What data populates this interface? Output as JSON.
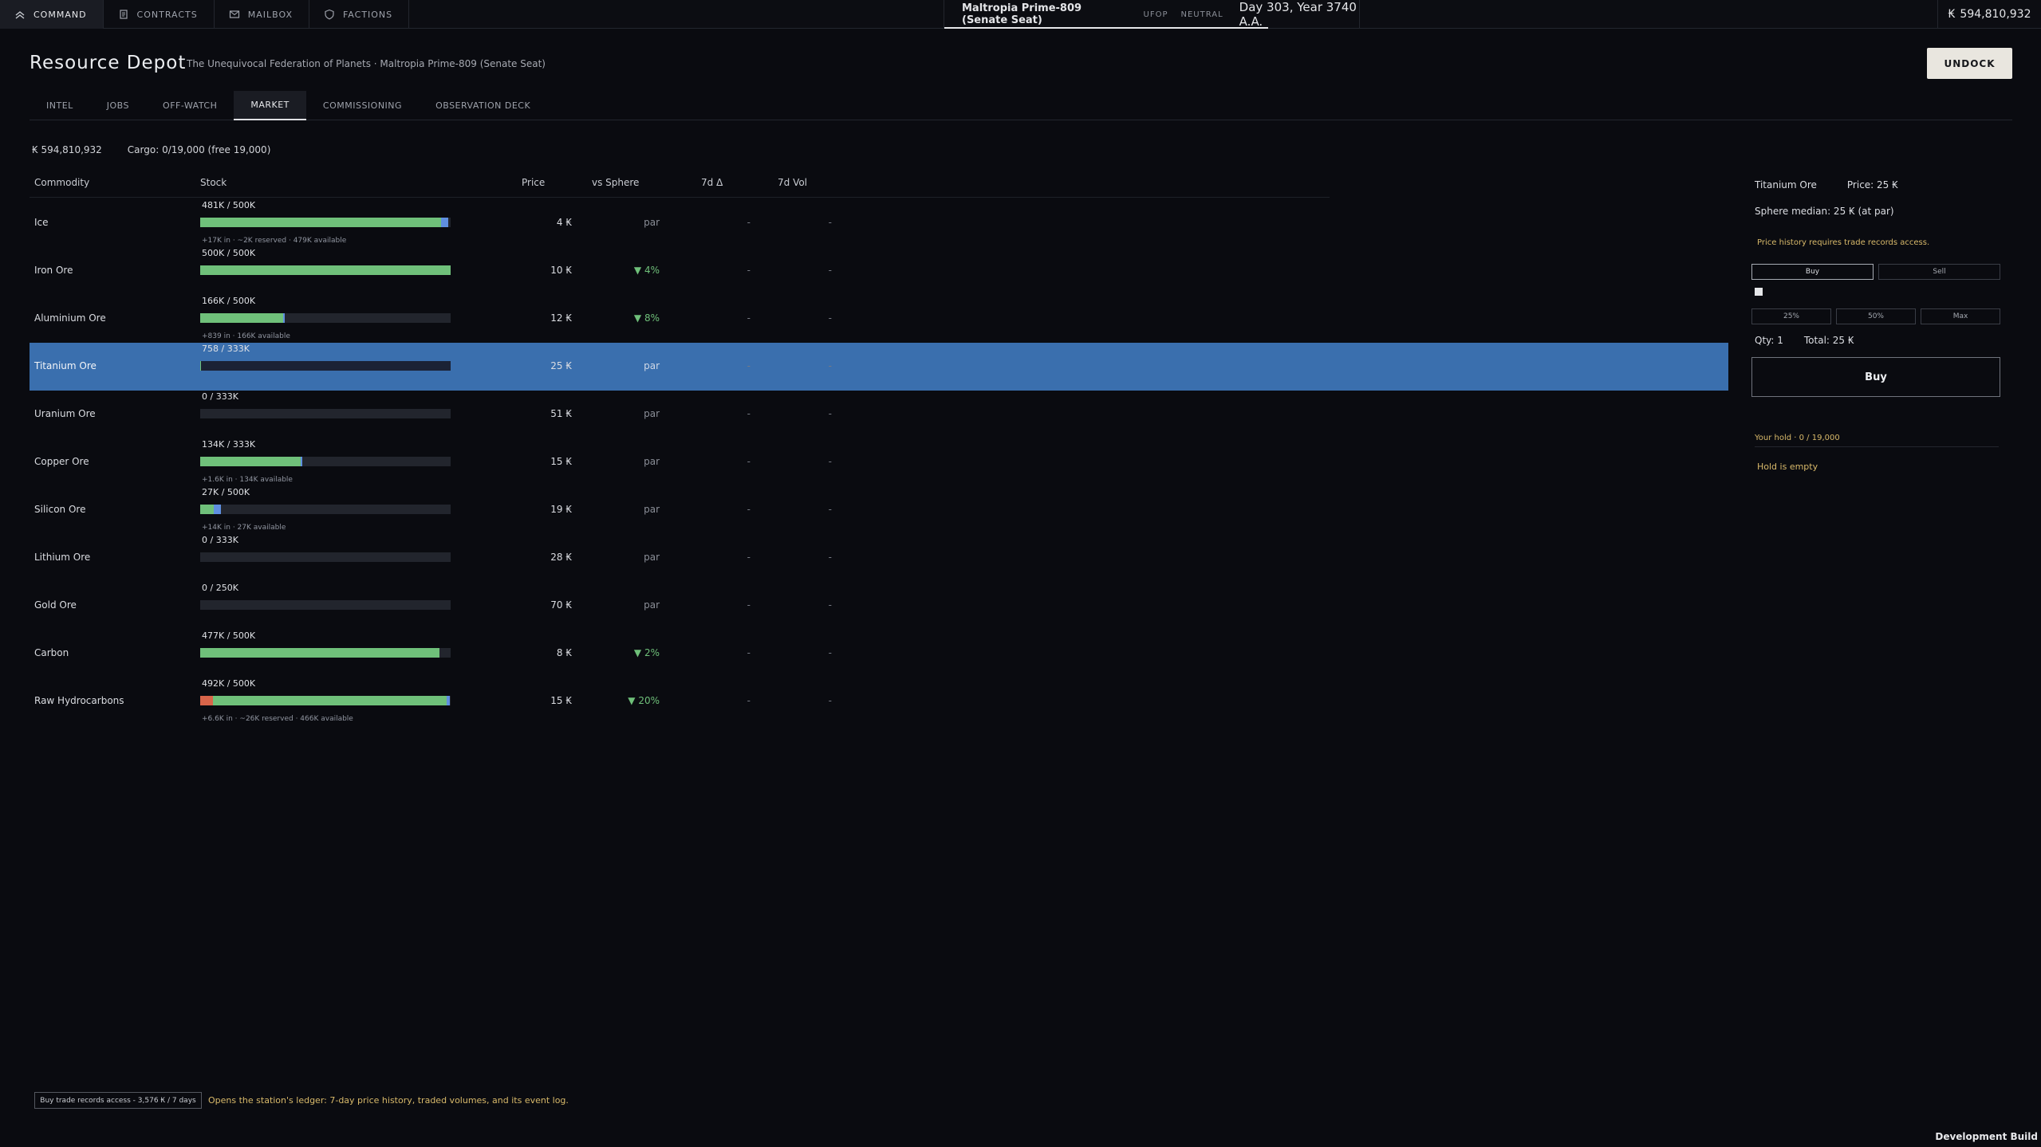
{
  "topbar": {
    "nav": [
      {
        "label": "COMMAND",
        "icon": "command-chevrons-icon"
      },
      {
        "label": "CONTRACTS",
        "icon": "document-icon"
      },
      {
        "label": "MAILBOX",
        "icon": "mail-icon"
      },
      {
        "label": "FACTIONS",
        "icon": "shield-icon"
      }
    ],
    "station_name": "Maltropia Prime-809 (Senate Seat)",
    "faction_tag": "UFOP",
    "standing_tag": "NEUTRAL",
    "date": "Day 303, Year 3740 A.A.",
    "credits": "594,810,932",
    "currency_symbol": "₭"
  },
  "header": {
    "title": "Resource Depot",
    "subtitle": "The Unequivocal Federation of Planets · Maltropia Prime-809 (Senate Seat)",
    "undock_label": "UNDOCK"
  },
  "tabs": [
    "INTEL",
    "JOBS",
    "OFF-WATCH",
    "MARKET",
    "COMMISSIONING",
    "OBSERVATION DECK"
  ],
  "summary": {
    "credits": "₭ 594,810,932",
    "cargo": "Cargo: 0/19,000 (free 19,000)"
  },
  "table": {
    "columns": {
      "commodity": "Commodity",
      "stock": "Stock",
      "price": "Price",
      "vs_sphere": "vs Sphere",
      "d7": "7d Δ",
      "vol7": "7d Vol"
    },
    "rows": [
      {
        "name": "Ice",
        "stock": "481K / 500K",
        "fill": 0.962,
        "reserved": 0,
        "incoming": 0.03,
        "sub": "+17K in  ·  ~2K reserved  ·  479K available",
        "price": "4 ₭",
        "sphere": "par",
        "sphere_down": false,
        "d7": "-",
        "vol": "-"
      },
      {
        "name": "Iron Ore",
        "stock": "500K / 500K",
        "fill": 1.0,
        "reserved": 0,
        "incoming": 0,
        "sub": "",
        "price": "10 ₭",
        "sphere": "▼ 4%",
        "sphere_down": true,
        "d7": "-",
        "vol": "-"
      },
      {
        "name": "Aluminium Ore",
        "stock": "166K / 500K",
        "fill": 0.332,
        "reserved": 0,
        "incoming": 0.004,
        "sub": "+839 in  ·  166K available",
        "price": "12 ₭",
        "sphere": "▼ 8%",
        "sphere_down": true,
        "d7": "-",
        "vol": "-"
      },
      {
        "name": "Titanium Ore",
        "stock": "758 / 333K",
        "fill": 0.002,
        "reserved": 0,
        "incoming": 0,
        "sub": "",
        "price": "25 ₭",
        "sphere": "par",
        "sphere_down": false,
        "d7": "-",
        "vol": "-",
        "selected": true
      },
      {
        "name": "Uranium Ore",
        "stock": "0 / 333K",
        "fill": 0,
        "reserved": 0,
        "incoming": 0,
        "sub": "",
        "price": "51 ₭",
        "sphere": "par",
        "sphere_down": false,
        "d7": "-",
        "vol": "-"
      },
      {
        "name": "Copper Ore",
        "stock": "134K / 333K",
        "fill": 0.402,
        "reserved": 0,
        "incoming": 0.005,
        "sub": "+1.6K in  ·  134K available",
        "price": "15 ₭",
        "sphere": "par",
        "sphere_down": false,
        "d7": "-",
        "vol": "-"
      },
      {
        "name": "Silicon Ore",
        "stock": "27K / 500K",
        "fill": 0.054,
        "reserved": 0,
        "incoming": 0.028,
        "sub": "+14K in  ·  27K available",
        "price": "19 ₭",
        "sphere": "par",
        "sphere_down": false,
        "d7": "-",
        "vol": "-"
      },
      {
        "name": "Lithium Ore",
        "stock": "0 / 333K",
        "fill": 0,
        "reserved": 0,
        "incoming": 0,
        "sub": "",
        "price": "28 ₭",
        "sphere": "par",
        "sphere_down": false,
        "d7": "-",
        "vol": "-"
      },
      {
        "name": "Gold Ore",
        "stock": "0 / 250K",
        "fill": 0,
        "reserved": 0,
        "incoming": 0,
        "sub": "",
        "price": "70 ₭",
        "sphere": "par",
        "sphere_down": false,
        "d7": "-",
        "vol": "-"
      },
      {
        "name": "Carbon",
        "stock": "477K / 500K",
        "fill": 0.954,
        "reserved": 0,
        "incoming": 0,
        "sub": "",
        "price": "8 ₭",
        "sphere": "▼ 2%",
        "sphere_down": true,
        "d7": "-",
        "vol": "-"
      },
      {
        "name": "Raw Hydrocarbons",
        "stock": "492K / 500K",
        "fill": 0.984,
        "reserved": 0.052,
        "incoming": 0.013,
        "sub": "+6.6K in  ·  ~26K reserved  ·  466K available",
        "price": "15 ₭",
        "sphere": "▼ 20%",
        "sphere_down": true,
        "d7": "-",
        "vol": "-"
      }
    ]
  },
  "panel": {
    "commodity": "Titanium Ore",
    "price": "Price: 25 ₭",
    "median": "Sphere median: 25 ₭ (at par)",
    "warning": "Price history requires trade records access.",
    "buy_toggle": "Buy",
    "sell_toggle": "Sell",
    "quantity_fraction": 0,
    "pct_25": "25%",
    "pct_50": "50%",
    "pct_max": "Max",
    "qty": "Qty: 1",
    "total": "Total: 25 ₭",
    "buy_button": "Buy",
    "hold_label": "Your hold · 0 / 19,000",
    "hold_empty": "Hold is empty"
  },
  "footer": {
    "records_button": "Buy trade records access - 3,576 ₭ / 7 days",
    "records_desc": "Opens the station's ledger: 7-day price history, traded volumes, and its event log.",
    "build_label": "Development Build"
  },
  "colors": {
    "accent_selected": "#3a6fae",
    "stock_green": "#6fc07a",
    "stock_incoming": "#5f8fe0",
    "stock_reserved": "#d8654a",
    "warning_text": "#d8b96a"
  }
}
